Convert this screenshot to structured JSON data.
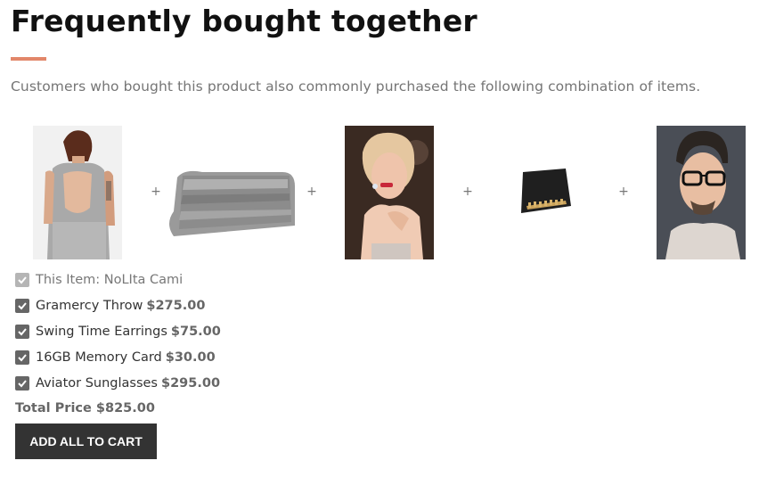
{
  "header": {
    "title": "Frequently bought together",
    "subtitle": "Customers who bought this product also commonly purchased the following combination of items."
  },
  "colors": {
    "accent": "#e2876a",
    "button_bg": "#333333",
    "checkbox": "#666666",
    "checkbox_disabled": "#b5b5b5"
  },
  "products": [
    {
      "icon": "cami-photo"
    },
    {
      "icon": "throw-photo"
    },
    {
      "icon": "earrings-model-photo"
    },
    {
      "icon": "memory-card-photo"
    },
    {
      "icon": "sunglasses-model-photo"
    }
  ],
  "items": [
    {
      "name": "This Item: NoLIta Cami",
      "price": "",
      "checked": true,
      "disabled": true
    },
    {
      "name": "Gramercy Throw",
      "price": "$275.00",
      "checked": true,
      "disabled": false
    },
    {
      "name": "Swing Time Earrings",
      "price": "$75.00",
      "checked": true,
      "disabled": false
    },
    {
      "name": "16GB Memory Card",
      "price": "$30.00",
      "checked": true,
      "disabled": false
    },
    {
      "name": "Aviator Sunglasses",
      "price": "$295.00",
      "checked": true,
      "disabled": false
    }
  ],
  "total": {
    "label": "Total Price",
    "value": "$825.00"
  },
  "cart_button": {
    "label": "ADD ALL TO CART"
  }
}
